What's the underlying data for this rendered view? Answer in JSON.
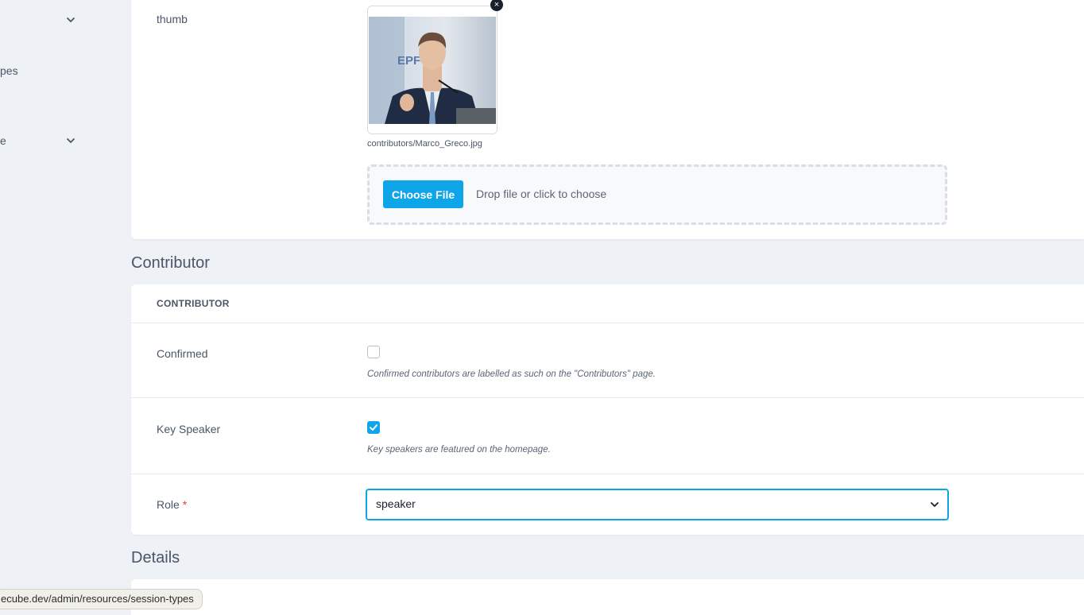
{
  "sidebar": {
    "items": [
      {
        "label": "",
        "has_chevron": true
      },
      {
        "label": "pes",
        "has_chevron": false
      },
      {
        "label": "e",
        "has_chevron": true
      }
    ]
  },
  "thumb_section": {
    "label": "thumb",
    "file_name": "contributors/Marco_Greco.jpg",
    "remove_icon": "×",
    "choose_button": "Choose File",
    "drop_text": "Drop file or click to choose"
  },
  "contributor": {
    "section_title": "Contributor",
    "card_heading": "CONTRIBUTOR",
    "confirmed": {
      "label": "Confirmed",
      "checked": false,
      "help": "Confirmed contributors are labelled as such on the \"Contributors\" page."
    },
    "key_speaker": {
      "label": "Key Speaker",
      "checked": true,
      "help": "Key speakers are featured on the homepage."
    },
    "role": {
      "label": "Role",
      "required_mark": "*",
      "value": "speaker"
    }
  },
  "details": {
    "section_title": "Details"
  },
  "status_bar": {
    "url": "ecube.dev/admin/resources/session-types"
  },
  "colors": {
    "accent": "#0ea5e9",
    "background": "#eef2f7",
    "required": "#e53e3e"
  }
}
